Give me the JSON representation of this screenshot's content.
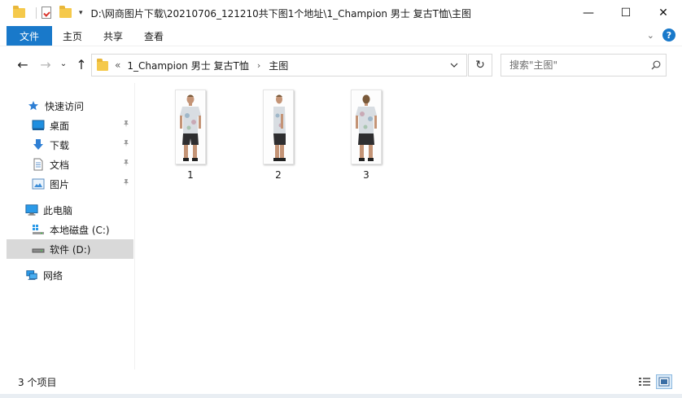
{
  "window": {
    "title": "D:\\网商图片下载\\20210706_121210共下图1个地址\\1_Champion 男士 复古T恤\\主图",
    "controls": {
      "minimize": "—",
      "maximize": "☐",
      "close": "✕"
    }
  },
  "ribbon": {
    "file_tab": "文件",
    "tabs": [
      "主页",
      "共享",
      "查看"
    ],
    "expand_glyph": "⌄",
    "help_glyph": "?"
  },
  "navigation": {
    "back": "←",
    "forward": "→",
    "recent_glyph": "⌄",
    "up": "↑",
    "address": {
      "overflow_glyph": "«",
      "crumbs": [
        "1_Champion 男士 复古T恤",
        "主图"
      ],
      "separator": "›"
    },
    "refresh_glyph": "↻",
    "search_placeholder": "搜索\"主图\""
  },
  "sidebar": {
    "quick_access": "快速访问",
    "quick_items": [
      "桌面",
      "下载",
      "文档",
      "图片"
    ],
    "this_pc": "此电脑",
    "drives": [
      "本地磁盘 (C:)",
      "软件 (D:)"
    ],
    "network": "网络",
    "selected": "软件 (D:)",
    "pin_glyph": "📌"
  },
  "files": [
    {
      "name": "1",
      "icon": "image-thumbnail-front"
    },
    {
      "name": "2",
      "icon": "image-thumbnail-side"
    },
    {
      "name": "3",
      "icon": "image-thumbnail-back"
    }
  ],
  "status": {
    "item_count": "3 个项目"
  },
  "colors": {
    "accent": "#1979ca",
    "folder": "#f5c94b",
    "selected_bg": "#d9d9d9"
  }
}
